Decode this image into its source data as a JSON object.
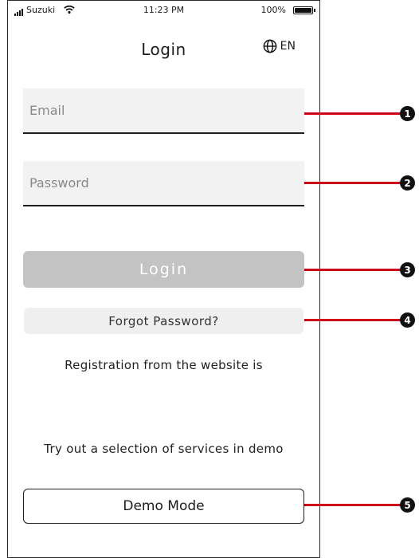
{
  "status_bar": {
    "carrier": "Suzuki",
    "time": "11:23 PM",
    "battery_percent": "100%",
    "battery_level": 1.0
  },
  "header": {
    "title": "Login",
    "language_label": "EN"
  },
  "form": {
    "email_placeholder": "Email",
    "password_placeholder": "Password",
    "login_label": "Login",
    "forgot_label": "Forgot Password?"
  },
  "info": {
    "registration_text": "Registration from the website is",
    "demo_text": "Try out a selection of services in demo"
  },
  "demo": {
    "button_label": "Demo Mode"
  },
  "callouts": [
    "1",
    "2",
    "3",
    "4",
    "5"
  ],
  "colors": {
    "callout_line": "#d0021b",
    "login_disabled": "#c3c3c3",
    "field_background": "#f2f2f2"
  }
}
